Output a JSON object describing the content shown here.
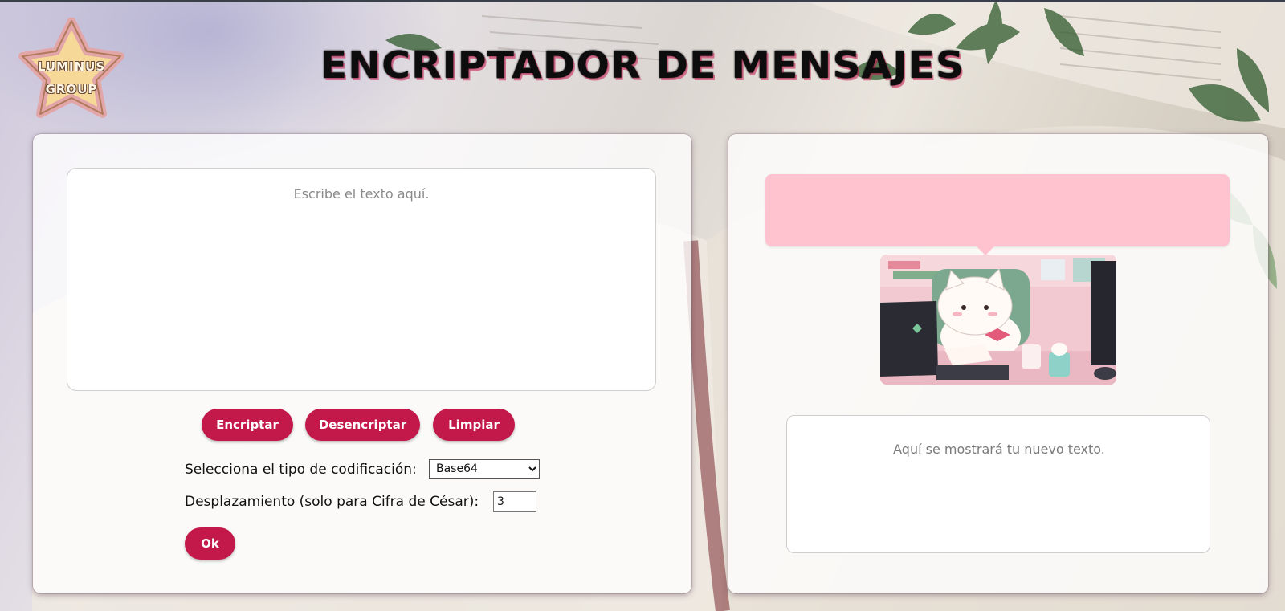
{
  "logo": {
    "line1": "LUMINUS",
    "line2": "GROUP"
  },
  "title": "ENCRIPTADOR DE MENSAJES",
  "input": {
    "placeholder": "Escribe el texto aquí.",
    "value": ""
  },
  "buttons": {
    "encrypt": "Encriptar",
    "decrypt": "Desencriptar",
    "clear": "Limpiar",
    "ok": "Ok"
  },
  "encoding": {
    "label": "Selecciona el tipo de codificación:",
    "selected": "Base64",
    "options": [
      "Base64"
    ]
  },
  "shift": {
    "label": "Desplazamiento (solo para Cifra de César):",
    "value": "3"
  },
  "output": {
    "placeholder": "Aquí se mostrará tu nuevo texto.",
    "bubble_text": ""
  },
  "colors": {
    "accent": "#c2184a",
    "bubble": "#fec3cf"
  },
  "icons": {
    "logo": "star-logo-icon",
    "illustration": "cat-at-desk-illustration"
  }
}
